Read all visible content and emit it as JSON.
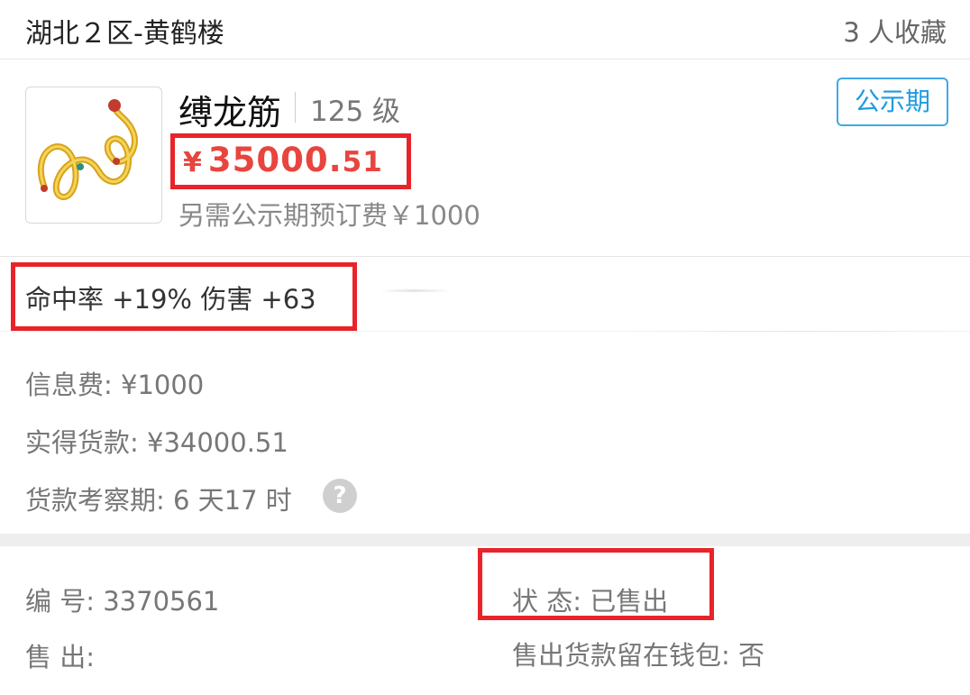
{
  "header": {
    "server": "湖北２区-黄鹤楼",
    "favorites": "3 人收藏"
  },
  "item": {
    "name": "缚龙筋",
    "level": "125 级",
    "badge": "公示期",
    "price": {
      "currency": "¥",
      "integer": "35000.",
      "decimal": "51"
    },
    "fee_note": "另需公示期预订费￥1000"
  },
  "attributes": "命中率 +19% 伤害 +63",
  "info": {
    "info_fee": "信息费: ¥1000",
    "actual_payment": "实得货款: ¥34000.51",
    "review_period": "货款考察期: 6 天17 时",
    "help_icon": "?"
  },
  "detail": {
    "serial_label": "编 号:",
    "serial_value": "3370561",
    "status_label": "状 态:",
    "status_value": "已售出",
    "sold_label": "售 出:",
    "wallet_label": "售出货款留在钱包:",
    "wallet_value": "否"
  },
  "colors": {
    "price": "#e8453f",
    "badge": "#1e9be0",
    "highlight_box": "#e8242a"
  },
  "icons": [
    "question-icon",
    "item-thumbnail-rope"
  ]
}
